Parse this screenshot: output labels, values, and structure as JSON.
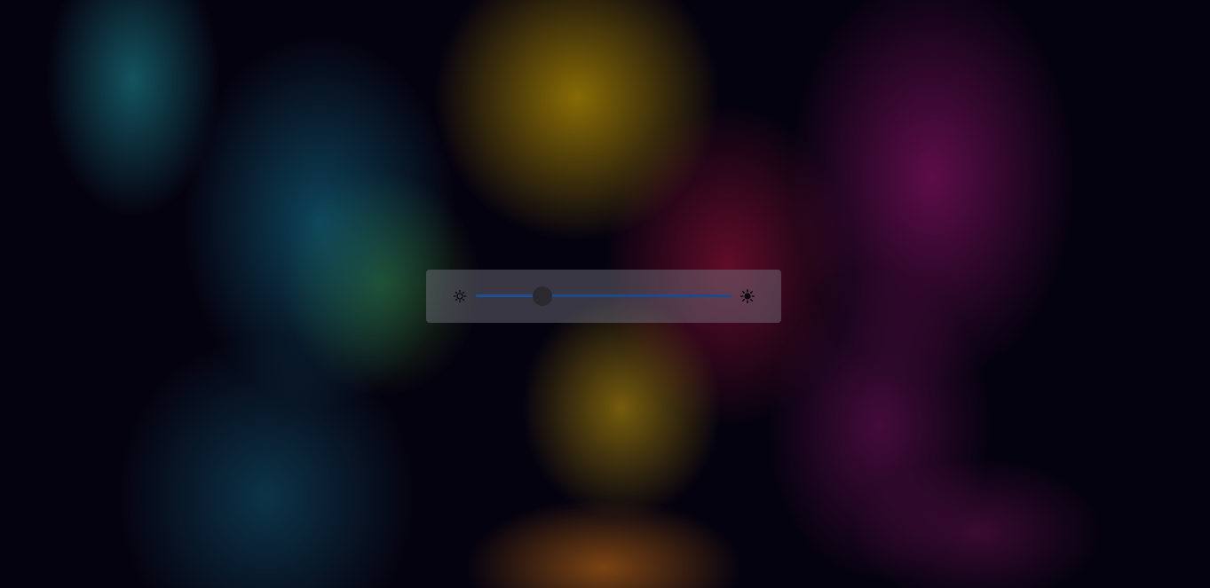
{
  "background": {
    "description_icon": "wallpaper-ink-smoke"
  },
  "brightness": {
    "low_icon": "brightness-low-icon",
    "high_icon": "brightness-high-icon",
    "level": 0.26,
    "min": 0,
    "max": 1,
    "track_color": "#1c4a8a",
    "thumb_color": "#2a2a2e"
  }
}
